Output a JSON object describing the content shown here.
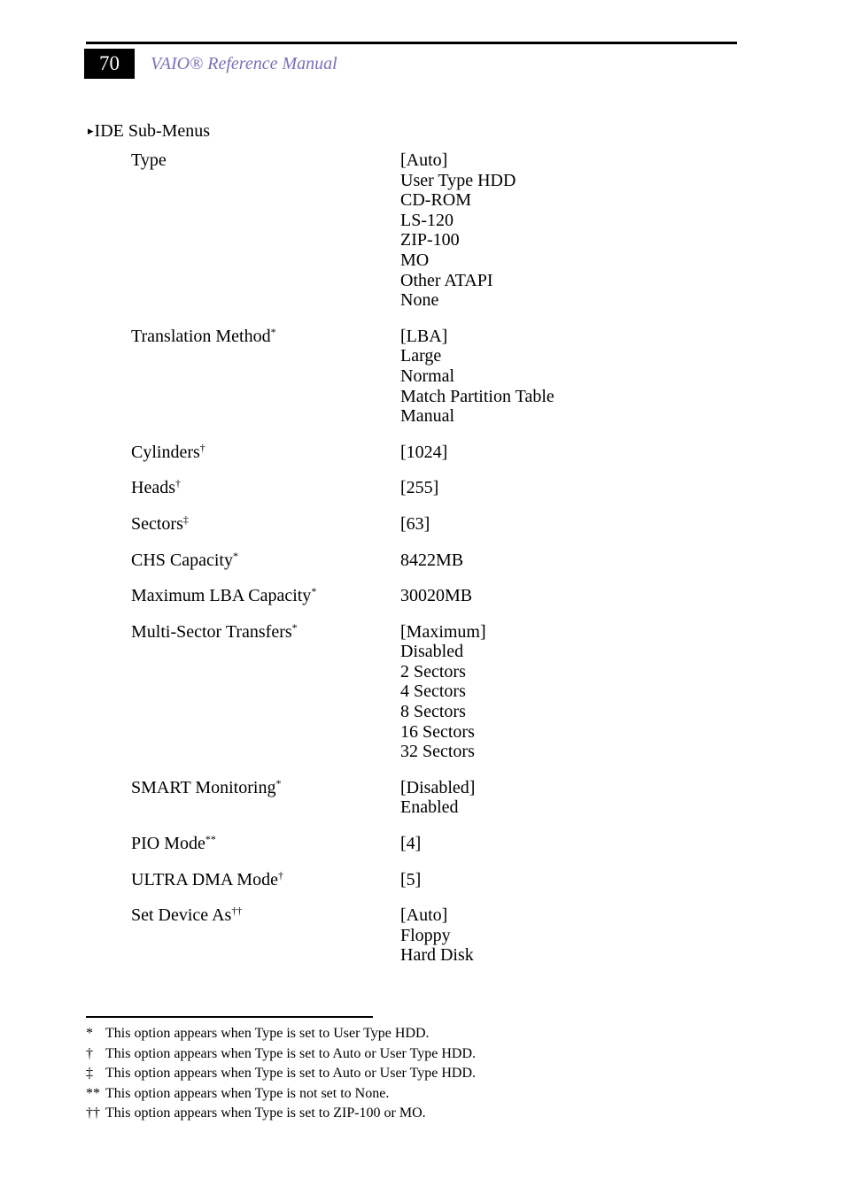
{
  "header": {
    "page_number": "70",
    "manual_title": "VAIO® Reference Manual",
    "accent_color": "#7b6fb5"
  },
  "section": {
    "bullet_icon": "▸",
    "heading": "IDE Sub-Menus"
  },
  "settings": [
    {
      "label": "Type",
      "footnote": "",
      "values": [
        "[Auto]",
        "User Type HDD",
        "CD-ROM",
        "LS-120",
        "ZIP-100",
        "MO",
        "Other ATAPI",
        "None"
      ]
    },
    {
      "label": "Translation Method",
      "footnote": "*",
      "values": [
        "[LBA]",
        "Large",
        "Normal",
        "Match Partition Table",
        "Manual"
      ]
    },
    {
      "label": "Cylinders",
      "footnote": "†",
      "values": [
        "[1024]"
      ]
    },
    {
      "label": "Heads",
      "footnote": "†",
      "values": [
        "[255]"
      ]
    },
    {
      "label": "Sectors",
      "footnote": "‡",
      "values": [
        "[63]"
      ]
    },
    {
      "label": "CHS Capacity",
      "footnote": "*",
      "values": [
        "8422MB"
      ]
    },
    {
      "label": "Maximum LBA Capacity",
      "footnote": "*",
      "values": [
        "30020MB"
      ]
    },
    {
      "label": "Multi-Sector Transfers",
      "footnote": "*",
      "values": [
        "[Maximum]",
        "Disabled",
        "2 Sectors",
        "4 Sectors",
        "8 Sectors",
        "16 Sectors",
        "32 Sectors"
      ]
    },
    {
      "label": "SMART Monitoring",
      "footnote": "*",
      "values": [
        "[Disabled]",
        "Enabled"
      ]
    },
    {
      "label": "PIO Mode",
      "footnote": "**",
      "values": [
        "[4]"
      ]
    },
    {
      "label": "ULTRA DMA Mode",
      "footnote": "†",
      "values": [
        "[5]"
      ]
    },
    {
      "label": "Set Device As",
      "footnote": "††",
      "values": [
        "[Auto]",
        "Floppy",
        "Hard Disk"
      ]
    }
  ],
  "footnotes": [
    {
      "marker": "*",
      "text": "This option appears when Type is set to User Type HDD."
    },
    {
      "marker": "†",
      "text": "This option appears when Type is set to Auto or User Type HDD."
    },
    {
      "marker": "‡",
      "text": "This option appears when Type is set to Auto or User Type HDD."
    },
    {
      "marker": "**",
      "text": "This option appears when Type is not set to None."
    },
    {
      "marker": "††",
      "text": "This option appears when Type is set to ZIP-100 or MO."
    }
  ]
}
